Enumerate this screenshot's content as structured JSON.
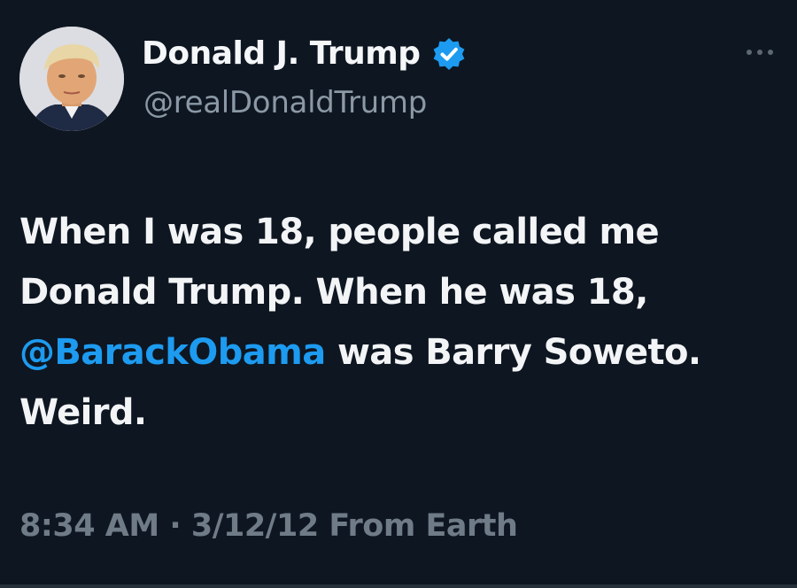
{
  "author": {
    "display_name": "Donald J. Trump",
    "handle": "@realDonaldTrump",
    "verified_icon": "verified-badge-icon",
    "avatar_icon": "profile-photo"
  },
  "tweet": {
    "text_parts": [
      "When I was 18, people called me Donald Trump. When he was 18, ",
      "@BarackObama",
      " was Barry Soweto. Weird."
    ],
    "time": "8:34 AM",
    "separator": " · ",
    "date": "3/12/12",
    "source": "From Earth"
  },
  "more_icon": "more-dots-icon",
  "colors": {
    "background": "#0e1621",
    "text": "#f2f4f6",
    "muted": "#8b98a5",
    "accent": "#1d9bf0"
  }
}
